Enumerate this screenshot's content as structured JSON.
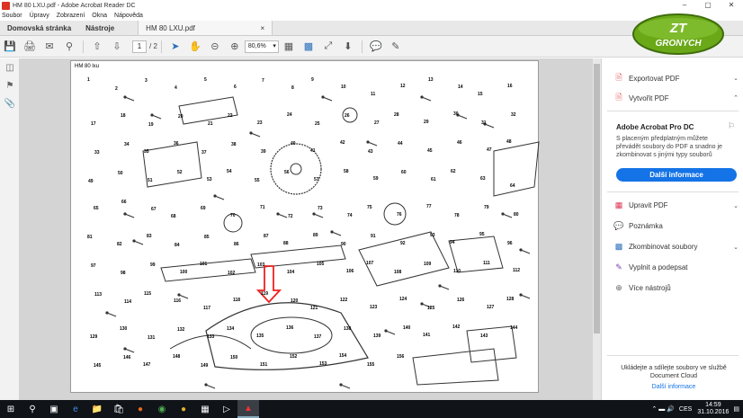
{
  "window": {
    "title": "HM 80 LXU.pdf - Adobe Acrobat Reader DC",
    "controls": [
      "–",
      "▢",
      "✕"
    ]
  },
  "menu": [
    "Soubor",
    "Úpravy",
    "Zobrazení",
    "Okna",
    "Nápověda"
  ],
  "tabs": {
    "home": "Domovská stránka",
    "tools": "Nástroje",
    "doc": "HM 80 LXU.pdf",
    "close": "×"
  },
  "toolbar": {
    "page_current": "1",
    "page_total": "/ 2",
    "zoom": "80,6%"
  },
  "document": {
    "header": "HM 80 lxu",
    "part_numbers": [
      "1",
      "2",
      "3",
      "4",
      "5",
      "6",
      "7",
      "8",
      "9",
      "10",
      "11",
      "12",
      "13",
      "14",
      "15",
      "16",
      "17",
      "18",
      "19",
      "20",
      "21",
      "22",
      "23",
      "24",
      "25",
      "26",
      "27",
      "28",
      "29",
      "30",
      "31",
      "32",
      "33",
      "34",
      "35",
      "36",
      "37",
      "38",
      "39",
      "40",
      "41",
      "42",
      "43",
      "44",
      "45",
      "46",
      "47",
      "48",
      "49",
      "50",
      "51",
      "52",
      "53",
      "54",
      "55",
      "56",
      "57",
      "58",
      "59",
      "60",
      "61",
      "62",
      "63",
      "64",
      "65",
      "66",
      "67",
      "68",
      "69",
      "70",
      "71",
      "72",
      "73",
      "74",
      "75",
      "76",
      "77",
      "78",
      "79",
      "80",
      "81",
      "82",
      "83",
      "84",
      "85",
      "86",
      "87",
      "88",
      "89",
      "90",
      "91",
      "92",
      "93",
      "94",
      "95",
      "96",
      "97",
      "98",
      "99",
      "100",
      "101",
      "102",
      "103",
      "104",
      "105",
      "106",
      "107",
      "108",
      "109",
      "110",
      "111",
      "112",
      "113",
      "114",
      "115",
      "116",
      "117",
      "118",
      "119",
      "120",
      "121",
      "122",
      "123",
      "124",
      "125",
      "126",
      "127",
      "128",
      "129",
      "130",
      "131",
      "132",
      "133",
      "134",
      "135",
      "136",
      "137",
      "138",
      "139",
      "140",
      "141",
      "142",
      "143",
      "144",
      "145",
      "146",
      "147",
      "148",
      "149",
      "150",
      "151",
      "152",
      "153",
      "154",
      "155",
      "156"
    ]
  },
  "right_panel": {
    "export_pdf": "Exportovat PDF",
    "create_pdf": "Vytvořit PDF",
    "promo_title": "Adobe Acrobat Pro DC",
    "promo_text": "S placeným předplatným můžete převádět soubory do PDF a snadno je zkombinovat s jinými typy souborů",
    "promo_button": "Další informace",
    "edit_pdf": "Upravit PDF",
    "comment": "Poznámka",
    "combine": "Zkombinovat soubory",
    "fill_sign": "Vyplnit a podepsat",
    "more_tools": "Více nástrojů",
    "cloud_text": "Ukládejte a sdílejte soubory ve službě Document Cloud",
    "cloud_link": "Další informace"
  },
  "logo": {
    "line1": "ZT",
    "line2": "GRONYCH"
  },
  "taskbar": {
    "lang": "CES",
    "time": "14:59",
    "date": "31.10.2016"
  }
}
